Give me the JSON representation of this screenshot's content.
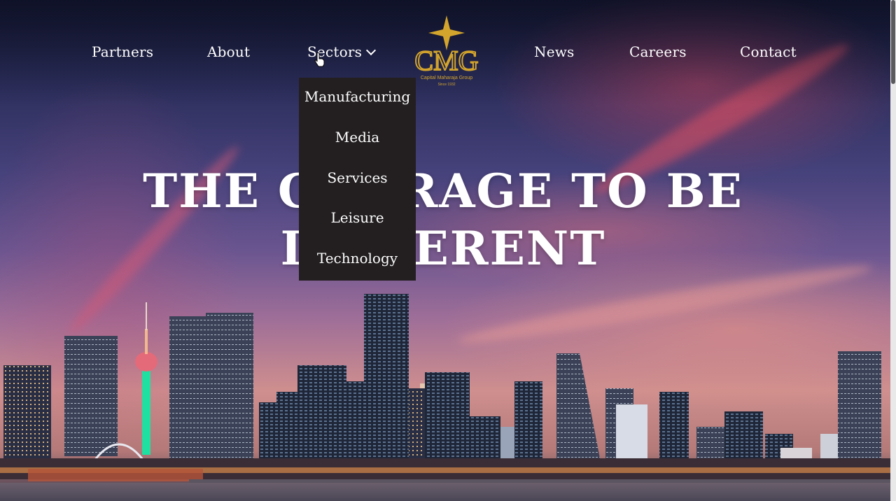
{
  "nav": {
    "left": [
      "Partners",
      "About",
      "Sectors"
    ],
    "right": [
      "News",
      "Careers",
      "Contact"
    ]
  },
  "logo": {
    "text": "CMG",
    "subtext": "Capital Maharaja Group",
    "since": "Since 1932",
    "color": "#d4a52c"
  },
  "dropdown": {
    "items": [
      "Manufacturing",
      "Media",
      "Services",
      "Leisure",
      "Technology"
    ]
  },
  "hero": {
    "line1": "THE COURAGE TO BE",
    "line2": "DIFFERENT"
  },
  "colors": {
    "dropdown_bg": "#231f20",
    "text": "#ffffff",
    "tower_glow": "#1fe0a0"
  }
}
